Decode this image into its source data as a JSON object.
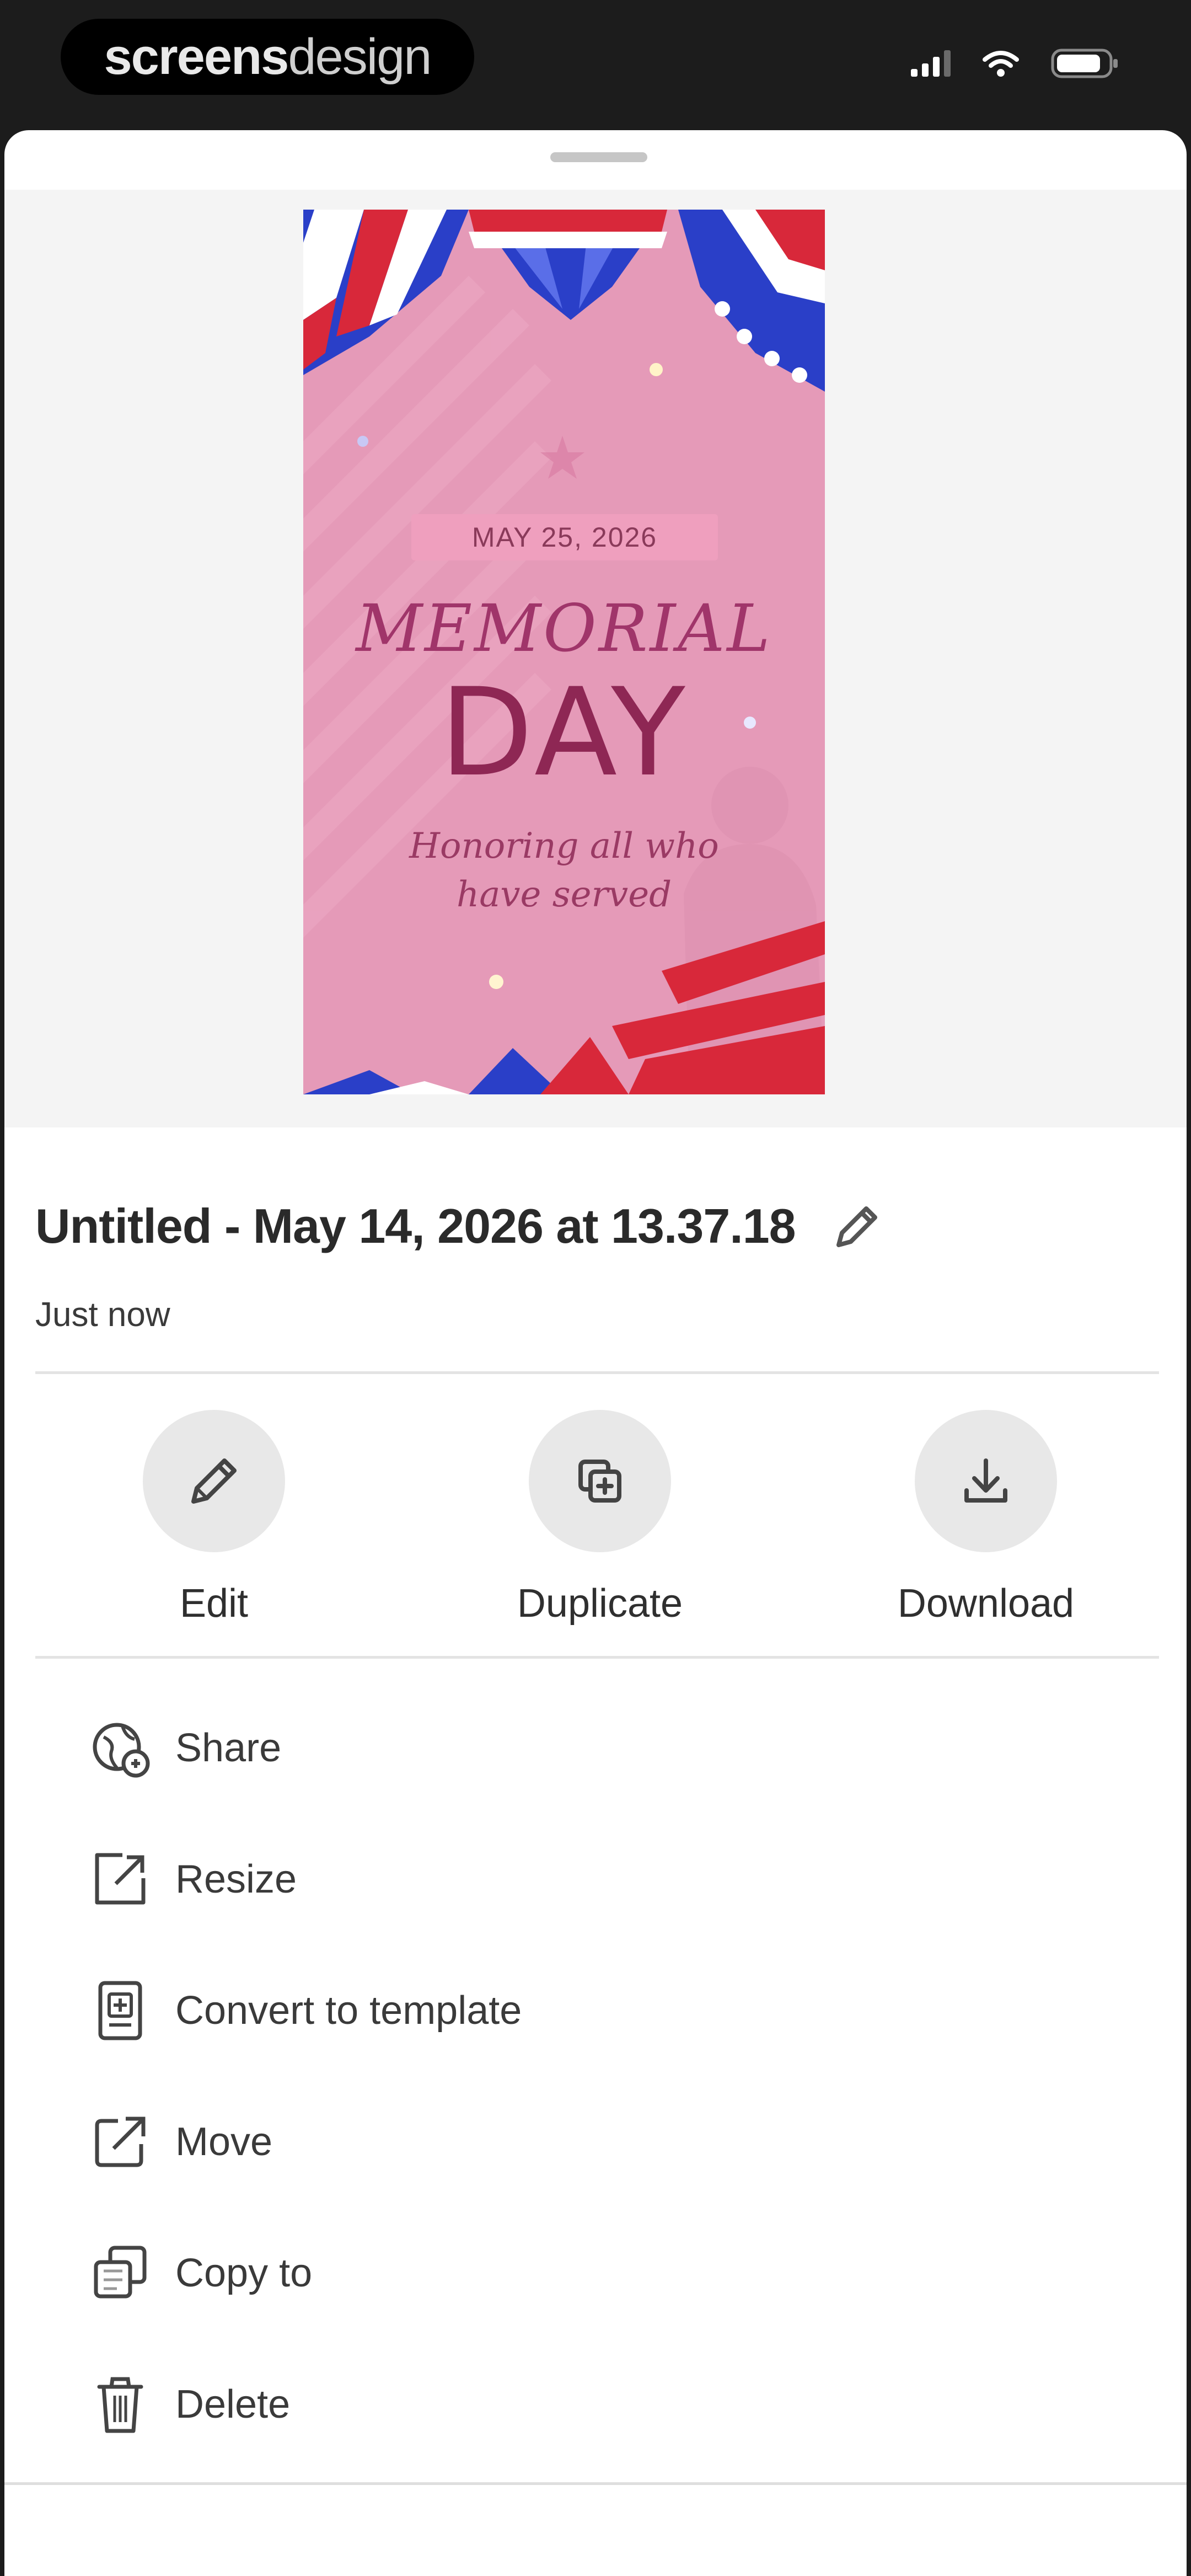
{
  "status_bar": {
    "brand_bold": "screens",
    "brand_light": "design"
  },
  "design": {
    "date": "MAY 25, 2026",
    "title_line1": "MEMORIAL",
    "title_line2": "DAY",
    "subtitle_line1": "Honoring all who",
    "subtitle_line2": "have served"
  },
  "document": {
    "title": "Untitled - May 14, 2026 at 13.37.18",
    "modified": "Just now"
  },
  "actions": [
    {
      "label": "Edit",
      "icon": "pencil-icon"
    },
    {
      "label": "Duplicate",
      "icon": "duplicate-icon"
    },
    {
      "label": "Download",
      "icon": "download-icon"
    }
  ],
  "menu": [
    {
      "label": "Share",
      "icon": "share-icon"
    },
    {
      "label": "Resize",
      "icon": "resize-icon"
    },
    {
      "label": "Convert to template",
      "icon": "template-icon"
    },
    {
      "label": "Move",
      "icon": "move-icon"
    },
    {
      "label": "Copy to",
      "icon": "copy-icon"
    },
    {
      "label": "Delete",
      "icon": "trash-icon"
    }
  ],
  "colors": {
    "design_background": "#e59ab8",
    "design_text": "#8e2754",
    "flag_red": "#d8283a",
    "flag_blue": "#2a3fc8"
  }
}
